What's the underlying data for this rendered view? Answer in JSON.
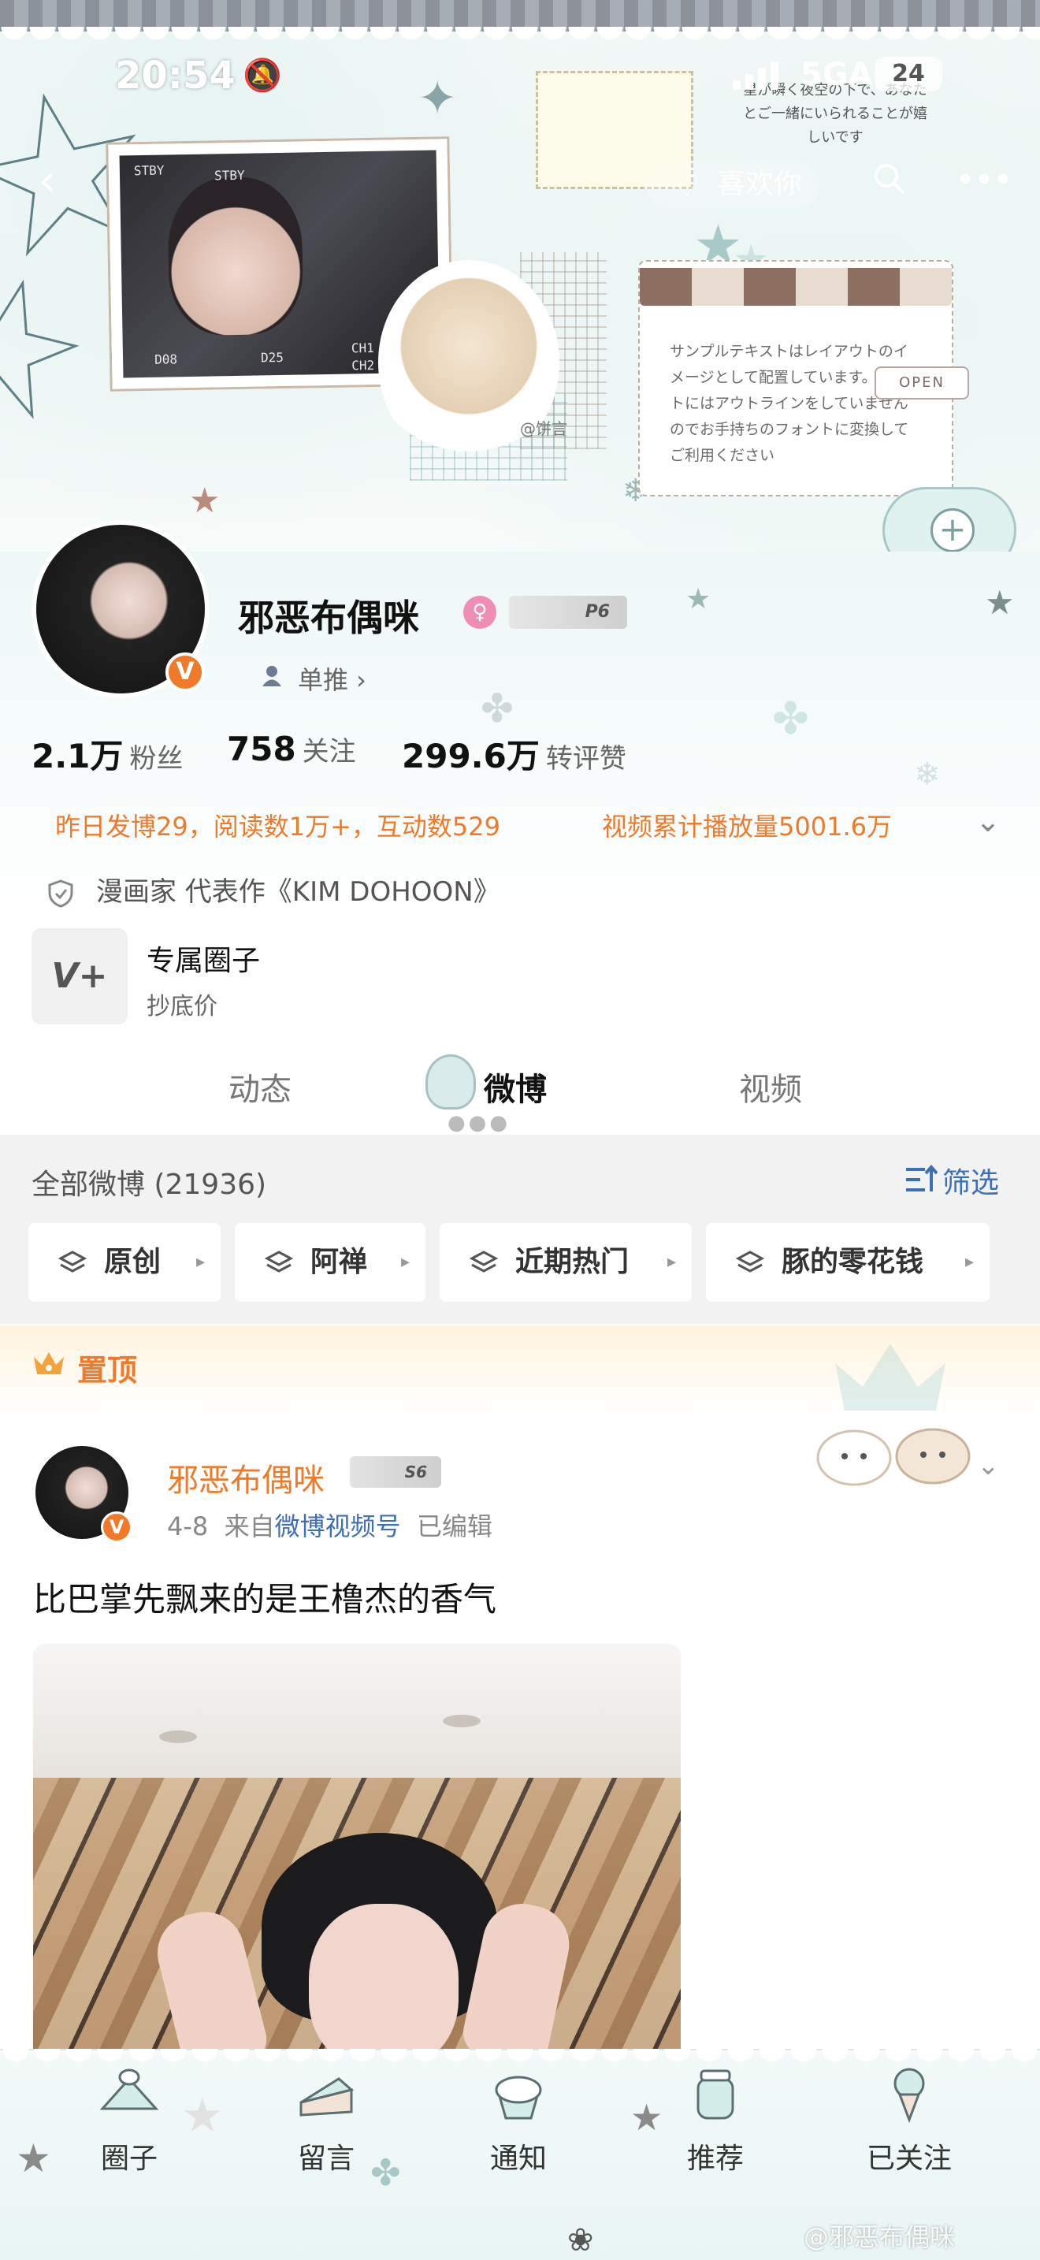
{
  "status_bar": {
    "time": "20:54",
    "network": "5GA",
    "battery": "24"
  },
  "header": {
    "fan_button_label": "喜欢你",
    "back_icon": "chevron-left-icon",
    "search_icon": "search-icon",
    "more_icon": "more-dots-icon",
    "photo_hud": [
      "STBY",
      "STBY",
      "D08",
      "D25",
      "CH1",
      "CH2"
    ],
    "note_text": "サンプルテキストはレイアウトのイメージとして配置しています。テキストにはアウトラインをしていませんのでお手持ちのフォントに変換してご利用ください",
    "open_sign": "OPEN",
    "jp_note": "星が瞬く夜空の下で、あなたとご一緒にいられることが嬉しいです",
    "chibi_label": "@饼言"
  },
  "profile": {
    "name": "邪恶布偶咪",
    "level_badge": "P6",
    "dan_tui": "单推 ›",
    "stats": [
      {
        "value": "2.1万",
        "label": "粉丝"
      },
      {
        "value": "758",
        "label": "关注"
      },
      {
        "value": "299.6万",
        "label": "转评赞"
      }
    ],
    "activity_left": "昨日发博29，阅读数1万+，互动数529",
    "activity_right": "视频累计播放量5001.6万",
    "role": "漫画家 代表作《KIM DOHOON》",
    "circle_title": "专属圈子",
    "circle_sub": "抄底价"
  },
  "tabs": [
    {
      "label": "动态",
      "active": false
    },
    {
      "label": "微博",
      "active": true
    },
    {
      "label": "视频",
      "active": false
    }
  ],
  "filter": {
    "all_label": "全部微博 (21936)",
    "filter_label": "筛选",
    "chips": [
      "原创",
      "阿禅",
      "近期热门",
      "豚的零花钱"
    ]
  },
  "pinned": {
    "label": "置顶",
    "author": "邪恶布偶咪",
    "level_badge": "S6",
    "date": "4-8",
    "from_prefix": "来自",
    "source": "微博视频号",
    "edited": "已编辑",
    "text": "比巴掌先飘来的是王橹杰的香气"
  },
  "bottom_nav": [
    {
      "label": "圈子",
      "icon": "cake-icon"
    },
    {
      "label": "留言",
      "icon": "cake-slice-icon"
    },
    {
      "label": "通知",
      "icon": "cupcake-icon"
    },
    {
      "label": "推荐",
      "icon": "candy-jar-icon"
    },
    {
      "label": "已关注",
      "icon": "ice-cream-icon"
    }
  ],
  "watermark": "@邪恶布偶咪",
  "colors": {
    "accent_orange": "#f07a2a",
    "link_blue": "#3d6fb6",
    "mint": "#dff2f0"
  }
}
